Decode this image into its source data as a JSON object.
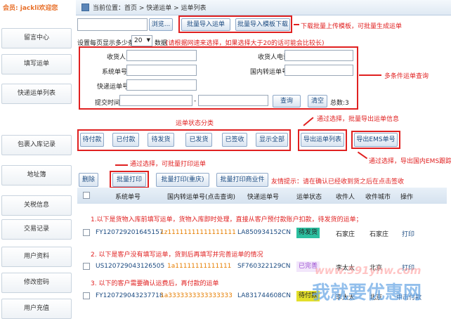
{
  "sidebar": {
    "user_prefix": "会员:",
    "user_name": "jackli欢迎您",
    "items": [
      "留言中心",
      "填写运单",
      "快递运单列表",
      "包裹入库记录",
      "地址簿",
      "关税信息",
      "交易记录",
      "用户资料",
      "修改密码",
      "用户充值"
    ]
  },
  "header": {
    "breadcrumb": "当前位置：首页 > 快递运单 > 运单列表",
    "browse_label": "浏览...",
    "import_label": "批量导入运单",
    "template_label": "批量导入模板下载",
    "import_note": "下载批量上传模板，可批量生成运单"
  },
  "pagesize": {
    "label_pre": "设置每页显示多少条:",
    "value": "20",
    "label_post": "数据",
    "hint": "(请根据网速来选择，如果选择大于20的话可能会比较长)"
  },
  "search": {
    "receiver_label": "收货人",
    "receiver_phone_label": "收货人电话",
    "order_no_label": "系统单号",
    "domestic_no_label": "国内转运单号",
    "express_no_label": "快递运单号",
    "time_label": "提交时间:",
    "time_sep": "-",
    "query_label": "查询",
    "clear_label": "清空",
    "total_label": "总数:3",
    "note": "多条件运单查询"
  },
  "status_filter": {
    "note": "运单状态分类",
    "buttons": [
      "待付款",
      "已付款",
      "待发货",
      "已发货",
      "已签收",
      "显示全部"
    ]
  },
  "export": {
    "list_label": "导出运单列表",
    "ems_label": "导出EMS单号",
    "list_note": "通过选择，批量导出运单信息",
    "ems_note": "通过选择，导出国内EMS跟踪号"
  },
  "actions": {
    "print_note": "通过选择，可批量打印运单",
    "delete_label": "删除",
    "print_label": "批量打印",
    "reprint_label": "批量打印(重庆)",
    "print_merchant_label": "批量打印商业件",
    "tip": "友情提示：请在确认已经收到货之后在点击签收"
  },
  "table": {
    "headers": [
      "系统单号",
      "国内转运单号(点击查询)",
      "快递运单号",
      "运单状态",
      "收件人",
      "收件城市",
      "操作"
    ],
    "notes": [
      "1.以下是货物入库前填写运单，货物入库即时处理，直接从客户预付款账户扣款，待发货的运单；",
      "2. 以下是客户没有填写运单，货到后再填写并完善运单的情况",
      "3. 以下的客户需要确认运费后，再付款的运单"
    ],
    "rows": [
      {
        "order": "FY120729201645157",
        "domestic": "1z11111111111111111",
        "express": "LA850934152CN",
        "status": "待发货",
        "status_color": "#2bbf9f",
        "receiver": "石家庄",
        "city": "石家庄",
        "op": "打印"
      },
      {
        "order": "US120729043126505",
        "domestic": "1a11111111111111",
        "express": "SF760322129CN",
        "status": "已完善",
        "status_color": "#9b4fd0",
        "receiver": "李太太",
        "city": "北京",
        "op": "打印"
      },
      {
        "order": "FY120729043237718",
        "domestic": "1a3333333333333333",
        "express": "LA831744608CN",
        "status": "待付款",
        "status_color": "#e3df2a",
        "receiver": "李太太",
        "city": "北京",
        "op": "中击付款"
      }
    ]
  },
  "watermark": {
    "url": "www.591yhw.com",
    "brand": "我就要优惠网"
  }
}
